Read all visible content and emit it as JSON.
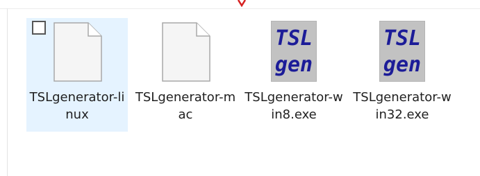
{
  "files": [
    {
      "name": "TSLgenerator-linux",
      "type": "generic",
      "selected": true
    },
    {
      "name": "TSLgenerator-mac",
      "type": "generic",
      "selected": false
    },
    {
      "name": "TSLgenerator-win8.exe",
      "type": "tsl-exe",
      "selected": false
    },
    {
      "name": "TSLgenerator-win32.exe",
      "type": "tsl-exe",
      "selected": false
    }
  ],
  "tsl_icon": {
    "line1": "TSL",
    "line2": "gen"
  },
  "colors": {
    "selection_background": "#e5f3ff",
    "exe_icon_background": "#c2c2c2",
    "exe_icon_text": "#1c1c98",
    "top_mark": "#d62020"
  }
}
